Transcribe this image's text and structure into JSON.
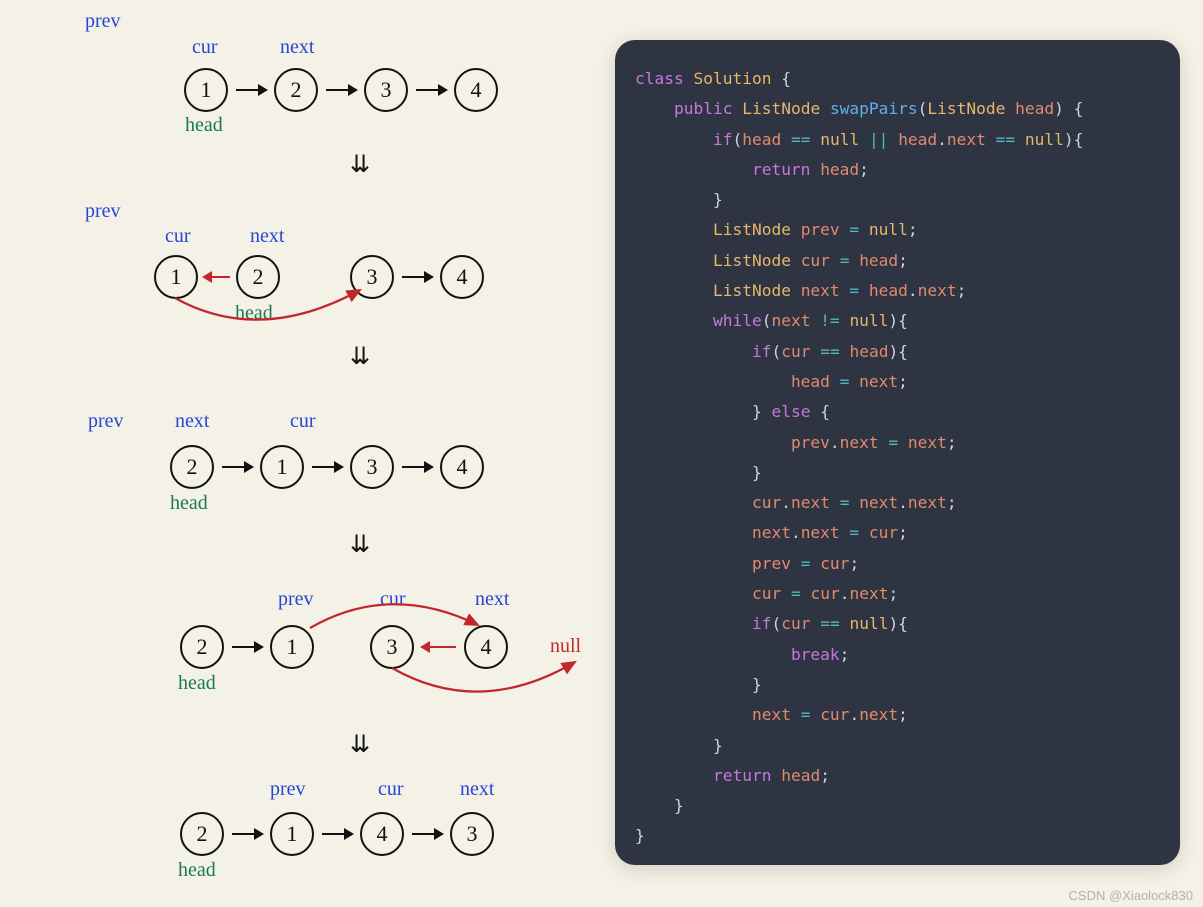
{
  "diagram": {
    "labels": {
      "prev": "prev",
      "cur": "cur",
      "next": "next",
      "head": "head",
      "null": "null"
    },
    "down_arrow": "⇊",
    "steps": [
      {
        "nodes": [
          "1",
          "2",
          "3",
          "4"
        ],
        "prev_at": null,
        "cur_at": 0,
        "next_at": 1,
        "head_at": 0
      },
      {
        "nodes": [
          "1",
          "2",
          "3",
          "4"
        ],
        "prev_at": null,
        "cur_at": 0,
        "next_at": 1,
        "head_at": 1
      },
      {
        "nodes": [
          "2",
          "1",
          "3",
          "4"
        ],
        "prev_at": null,
        "cur_at": 1,
        "next_at": 0,
        "head_at": 0
      },
      {
        "nodes": [
          "2",
          "1",
          "3",
          "4"
        ],
        "prev_at": 1,
        "cur_at": 2,
        "next_at": 3,
        "head_at": 0
      },
      {
        "nodes": [
          "2",
          "1",
          "4",
          "3"
        ],
        "prev_at": 1,
        "cur_at": 2,
        "next_at": 3,
        "head_at": 0
      }
    ]
  },
  "code": {
    "tokens": [
      [
        [
          "kw-class",
          "class"
        ],
        [
          "",
          ""
        ],
        [
          "kw-type",
          " Solution"
        ],
        [
          "punct",
          " {"
        ]
      ],
      [
        [
          "",
          "    "
        ],
        [
          "kw-ret",
          "public"
        ],
        [
          "",
          " "
        ],
        [
          "kw-type",
          "ListNode"
        ],
        [
          "",
          " "
        ],
        [
          "fn",
          "swapPairs"
        ],
        [
          "punct",
          "("
        ],
        [
          "kw-type",
          "ListNode"
        ],
        [
          "",
          " "
        ],
        [
          "param",
          "head"
        ],
        [
          "punct",
          ") {"
        ]
      ],
      [
        [
          "",
          "        "
        ],
        [
          "kw-ctrl",
          "if"
        ],
        [
          "punct",
          "("
        ],
        [
          "var",
          "head"
        ],
        [
          "",
          " "
        ],
        [
          "op",
          "=="
        ],
        [
          "",
          " "
        ],
        [
          "null",
          "null"
        ],
        [
          "",
          " "
        ],
        [
          "op",
          "||"
        ],
        [
          "",
          " "
        ],
        [
          "var",
          "head"
        ],
        [
          "punct",
          "."
        ],
        [
          "var",
          "next"
        ],
        [
          "",
          " "
        ],
        [
          "op",
          "=="
        ],
        [
          "",
          " "
        ],
        [
          "null",
          "null"
        ],
        [
          "punct",
          "){"
        ]
      ],
      [
        [
          "",
          "            "
        ],
        [
          "kw-ctrl",
          "return"
        ],
        [
          "",
          " "
        ],
        [
          "var",
          "head"
        ],
        [
          "punct",
          ";"
        ]
      ],
      [
        [
          "",
          "        "
        ],
        [
          "punct",
          "}"
        ]
      ],
      [
        [
          "",
          "        "
        ],
        [
          "kw-type",
          "ListNode"
        ],
        [
          "",
          " "
        ],
        [
          "var",
          "prev"
        ],
        [
          "",
          " "
        ],
        [
          "op",
          "="
        ],
        [
          "",
          " "
        ],
        [
          "null",
          "null"
        ],
        [
          "punct",
          ";"
        ]
      ],
      [
        [
          "",
          "        "
        ],
        [
          "kw-type",
          "ListNode"
        ],
        [
          "",
          " "
        ],
        [
          "var",
          "cur"
        ],
        [
          "",
          " "
        ],
        [
          "op",
          "="
        ],
        [
          "",
          " "
        ],
        [
          "var",
          "head"
        ],
        [
          "punct",
          ";"
        ]
      ],
      [
        [
          "",
          "        "
        ],
        [
          "kw-type",
          "ListNode"
        ],
        [
          "",
          " "
        ],
        [
          "var",
          "next"
        ],
        [
          "",
          " "
        ],
        [
          "op",
          "="
        ],
        [
          "",
          " "
        ],
        [
          "var",
          "head"
        ],
        [
          "punct",
          "."
        ],
        [
          "var",
          "next"
        ],
        [
          "punct",
          ";"
        ]
      ],
      [
        [
          "",
          "        "
        ],
        [
          "kw-ctrl",
          "while"
        ],
        [
          "punct",
          "("
        ],
        [
          "var",
          "next"
        ],
        [
          "",
          " "
        ],
        [
          "op",
          "!="
        ],
        [
          "",
          " "
        ],
        [
          "null",
          "null"
        ],
        [
          "punct",
          "){"
        ]
      ],
      [
        [
          "",
          "            "
        ],
        [
          "kw-ctrl",
          "if"
        ],
        [
          "punct",
          "("
        ],
        [
          "var",
          "cur"
        ],
        [
          "",
          " "
        ],
        [
          "op",
          "=="
        ],
        [
          "",
          " "
        ],
        [
          "var",
          "head"
        ],
        [
          "punct",
          "){"
        ]
      ],
      [
        [
          "",
          "                "
        ],
        [
          "var",
          "head"
        ],
        [
          "",
          " "
        ],
        [
          "op",
          "="
        ],
        [
          "",
          " "
        ],
        [
          "var",
          "next"
        ],
        [
          "punct",
          ";"
        ]
      ],
      [
        [
          "",
          "            "
        ],
        [
          "punct",
          "}"
        ],
        [
          "",
          " "
        ],
        [
          "kw-ctrl",
          "else"
        ],
        [
          "",
          " "
        ],
        [
          "punct",
          "{"
        ]
      ],
      [
        [
          "",
          "                "
        ],
        [
          "var",
          "prev"
        ],
        [
          "punct",
          "."
        ],
        [
          "var",
          "next"
        ],
        [
          "",
          " "
        ],
        [
          "op",
          "="
        ],
        [
          "",
          " "
        ],
        [
          "var",
          "next"
        ],
        [
          "punct",
          ";"
        ]
      ],
      [
        [
          "",
          "            "
        ],
        [
          "punct",
          "}"
        ]
      ],
      [
        [
          "",
          "            "
        ],
        [
          "var",
          "cur"
        ],
        [
          "punct",
          "."
        ],
        [
          "var",
          "next"
        ],
        [
          "",
          " "
        ],
        [
          "op",
          "="
        ],
        [
          "",
          " "
        ],
        [
          "var",
          "next"
        ],
        [
          "punct",
          "."
        ],
        [
          "var",
          "next"
        ],
        [
          "punct",
          ";"
        ]
      ],
      [
        [
          "",
          "            "
        ],
        [
          "var",
          "next"
        ],
        [
          "punct",
          "."
        ],
        [
          "var",
          "next"
        ],
        [
          "",
          " "
        ],
        [
          "op",
          "="
        ],
        [
          "",
          " "
        ],
        [
          "var",
          "cur"
        ],
        [
          "punct",
          ";"
        ]
      ],
      [
        [
          "",
          "            "
        ],
        [
          "var",
          "prev"
        ],
        [
          "",
          " "
        ],
        [
          "op",
          "="
        ],
        [
          "",
          " "
        ],
        [
          "var",
          "cur"
        ],
        [
          "punct",
          ";"
        ]
      ],
      [
        [
          "",
          "            "
        ],
        [
          "var",
          "cur"
        ],
        [
          "",
          " "
        ],
        [
          "op",
          "="
        ],
        [
          "",
          " "
        ],
        [
          "var",
          "cur"
        ],
        [
          "punct",
          "."
        ],
        [
          "var",
          "next"
        ],
        [
          "punct",
          ";"
        ]
      ],
      [
        [
          "",
          "            "
        ],
        [
          "kw-ctrl",
          "if"
        ],
        [
          "punct",
          "("
        ],
        [
          "var",
          "cur"
        ],
        [
          "",
          " "
        ],
        [
          "op",
          "=="
        ],
        [
          "",
          " "
        ],
        [
          "null",
          "null"
        ],
        [
          "punct",
          "){"
        ]
      ],
      [
        [
          "",
          "                "
        ],
        [
          "kw-ctrl",
          "break"
        ],
        [
          "punct",
          ";"
        ]
      ],
      [
        [
          "",
          "            "
        ],
        [
          "punct",
          "}"
        ]
      ],
      [
        [
          "",
          "            "
        ],
        [
          "var",
          "next"
        ],
        [
          "",
          " "
        ],
        [
          "op",
          "="
        ],
        [
          "",
          " "
        ],
        [
          "var",
          "cur"
        ],
        [
          "punct",
          "."
        ],
        [
          "var",
          "next"
        ],
        [
          "punct",
          ";"
        ]
      ],
      [
        [
          "",
          "        "
        ],
        [
          "punct",
          "}"
        ]
      ],
      [
        [
          "",
          "        "
        ],
        [
          "kw-ctrl",
          "return"
        ],
        [
          "",
          " "
        ],
        [
          "var",
          "head"
        ],
        [
          "punct",
          ";"
        ]
      ],
      [
        [
          "",
          "    "
        ],
        [
          "punct",
          "}"
        ]
      ],
      [
        [
          "punct",
          "}"
        ]
      ]
    ]
  },
  "watermark": "CSDN @Xiaolock830"
}
